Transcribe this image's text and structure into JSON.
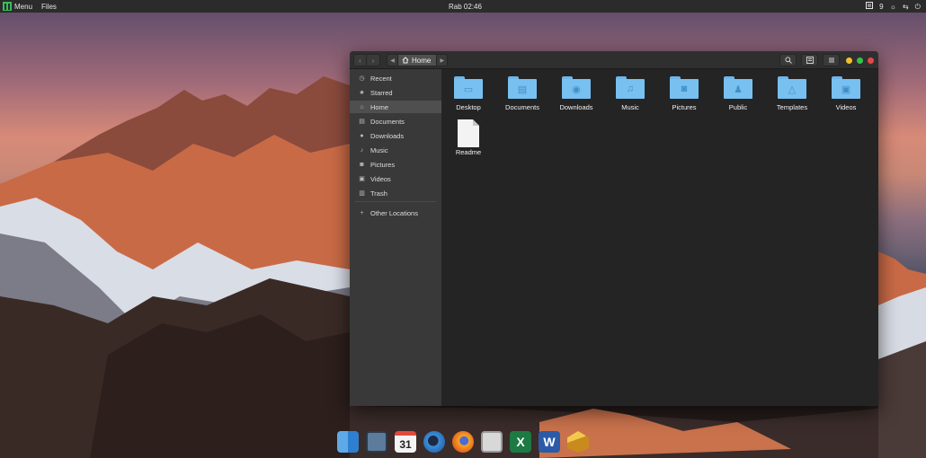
{
  "top_panel": {
    "menu_label": "Menu",
    "files_label": "Files",
    "clock": "Rab 02:46",
    "tray_count": "9"
  },
  "window": {
    "path_current": "Home",
    "sidebar": [
      {
        "label": "Recent",
        "icon": "clock-icon"
      },
      {
        "label": "Starred",
        "icon": "star-icon"
      },
      {
        "label": "Home",
        "icon": "home-icon",
        "active": true
      },
      {
        "label": "Documents",
        "icon": "document-icon"
      },
      {
        "label": "Downloads",
        "icon": "download-icon"
      },
      {
        "label": "Music",
        "icon": "music-icon"
      },
      {
        "label": "Pictures",
        "icon": "camera-icon"
      },
      {
        "label": "Videos",
        "icon": "film-icon"
      },
      {
        "label": "Trash",
        "icon": "trash-icon"
      }
    ],
    "other_locations": "Other Locations",
    "files": [
      {
        "label": "Desktop",
        "icon": "folder-desktop-icon"
      },
      {
        "label": "Documents",
        "icon": "folder-documents-icon"
      },
      {
        "label": "Downloads",
        "icon": "folder-downloads-icon"
      },
      {
        "label": "Music",
        "icon": "folder-music-icon"
      },
      {
        "label": "Pictures",
        "icon": "folder-pictures-icon"
      },
      {
        "label": "Public",
        "icon": "folder-public-icon"
      },
      {
        "label": "Templates",
        "icon": "folder-templates-icon"
      },
      {
        "label": "Videos",
        "icon": "folder-videos-icon"
      },
      {
        "label": "Readme",
        "icon": "text-file-icon"
      }
    ],
    "colors": {
      "folder": "#78c0f0",
      "close": "#e8474a",
      "maximize": "#37c248",
      "minimize": "#f2be2f"
    }
  },
  "dock": {
    "calendar_day": "31",
    "excel_letter": "X",
    "word_letter": "W",
    "apps": [
      "finder-icon",
      "image-viewer-icon",
      "calendar-icon",
      "browser-icon",
      "firefox-icon",
      "system-monitor-icon",
      "excel-icon",
      "word-icon",
      "package-icon"
    ]
  }
}
